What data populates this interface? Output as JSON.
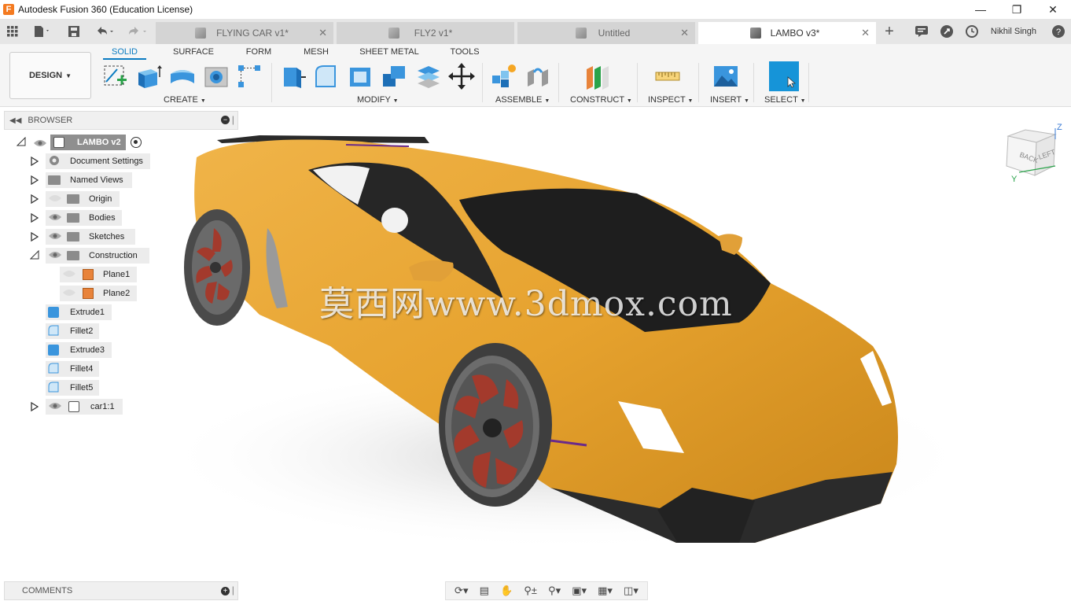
{
  "window": {
    "title": "Autodesk Fusion 360 (Education License)",
    "logo_letter": "F"
  },
  "tabs": [
    {
      "label": "FLYING CAR v1*",
      "active": false
    },
    {
      "label": "FLY2 v1*",
      "active": false
    },
    {
      "label": "Untitled",
      "active": false
    },
    {
      "label": "LAMBO v3*",
      "active": true
    }
  ],
  "user": {
    "name": "Nikhil Singh"
  },
  "workspace": {
    "label": "DESIGN"
  },
  "ribbon_tabs": [
    "SOLID",
    "SURFACE",
    "FORM",
    "MESH",
    "SHEET METAL",
    "TOOLS"
  ],
  "ribbon_groups": {
    "create": "CREATE",
    "modify": "MODIFY",
    "assemble": "ASSEMBLE",
    "construct": "CONSTRUCT",
    "inspect": "INSPECT",
    "insert": "INSERT",
    "select": "SELECT"
  },
  "browser": {
    "title": "BROWSER",
    "root": "LAMBO v2",
    "items": [
      {
        "label": "Document Settings"
      },
      {
        "label": "Named Views"
      },
      {
        "label": "Origin"
      },
      {
        "label": "Bodies"
      },
      {
        "label": "Sketches"
      },
      {
        "label": "Construction"
      },
      {
        "label": "Plane1"
      },
      {
        "label": "Plane2"
      },
      {
        "label": "Extrude1"
      },
      {
        "label": "Fillet2"
      },
      {
        "label": "Extrude3"
      },
      {
        "label": "Fillet4"
      },
      {
        "label": "Fillet5"
      },
      {
        "label": "car1:1"
      }
    ]
  },
  "comments": {
    "title": "COMMENTS"
  },
  "viewcube": {
    "back": "BACK",
    "left": "LEFT",
    "z": "Z",
    "y": "Y"
  },
  "watermark": "莫西网www.3dmox.com",
  "colors": {
    "accent": "#0a7bc1",
    "car_body": "#e9a634",
    "wheel_rim": "#a33a2c"
  }
}
